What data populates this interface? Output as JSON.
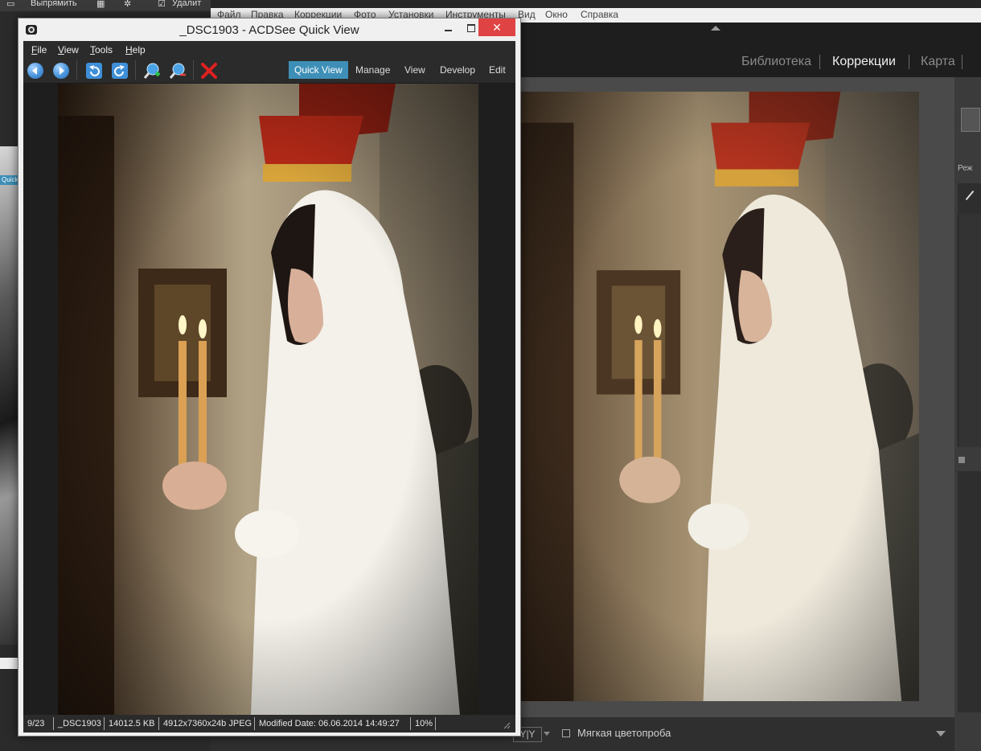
{
  "bg_left_app": {
    "toolbar_items": [
      "Выпрямить",
      "Удалит"
    ]
  },
  "lightroom": {
    "menu": [
      "Файл",
      "Правка",
      "Коррекции",
      "Фото",
      "Установки",
      "Инструменты",
      "Вид",
      "Окно",
      "Справка"
    ],
    "modules": [
      "Библиотека",
      "Коррекции",
      "Карта"
    ],
    "active_module": "Коррекции",
    "yy_label": "Y|Y",
    "soft_proof_label": "Мягкая цветопроба"
  },
  "qv": {
    "title": "_DSC1903 - ACDSee Quick View",
    "close_glyph": "✕",
    "menu": [
      "File",
      "View",
      "Tools",
      "Help"
    ],
    "menu_mnemonics": [
      "F",
      "V",
      "T",
      "H"
    ],
    "modes": [
      "Quick View",
      "Manage",
      "View",
      "Develop",
      "Edit"
    ],
    "active_mode": "Quick View",
    "toolbar_icons": [
      "back-icon",
      "forward-icon",
      "rotate-left-icon",
      "rotate-right-icon",
      "zoom-in-icon",
      "zoom-out-icon",
      "delete-icon"
    ],
    "status": {
      "index": "9/23",
      "filename": "_DSC1903",
      "size": "14012.5 KB",
      "dims": "4912x7360x24b JPEG",
      "modified": "Modified Date: 06.06.2014 14:49:27",
      "zoom": "10%"
    }
  },
  "colors": {
    "accent": "#3e8fb7",
    "close_red": "#e04343",
    "dark_chrome": "#2b2b2b"
  }
}
